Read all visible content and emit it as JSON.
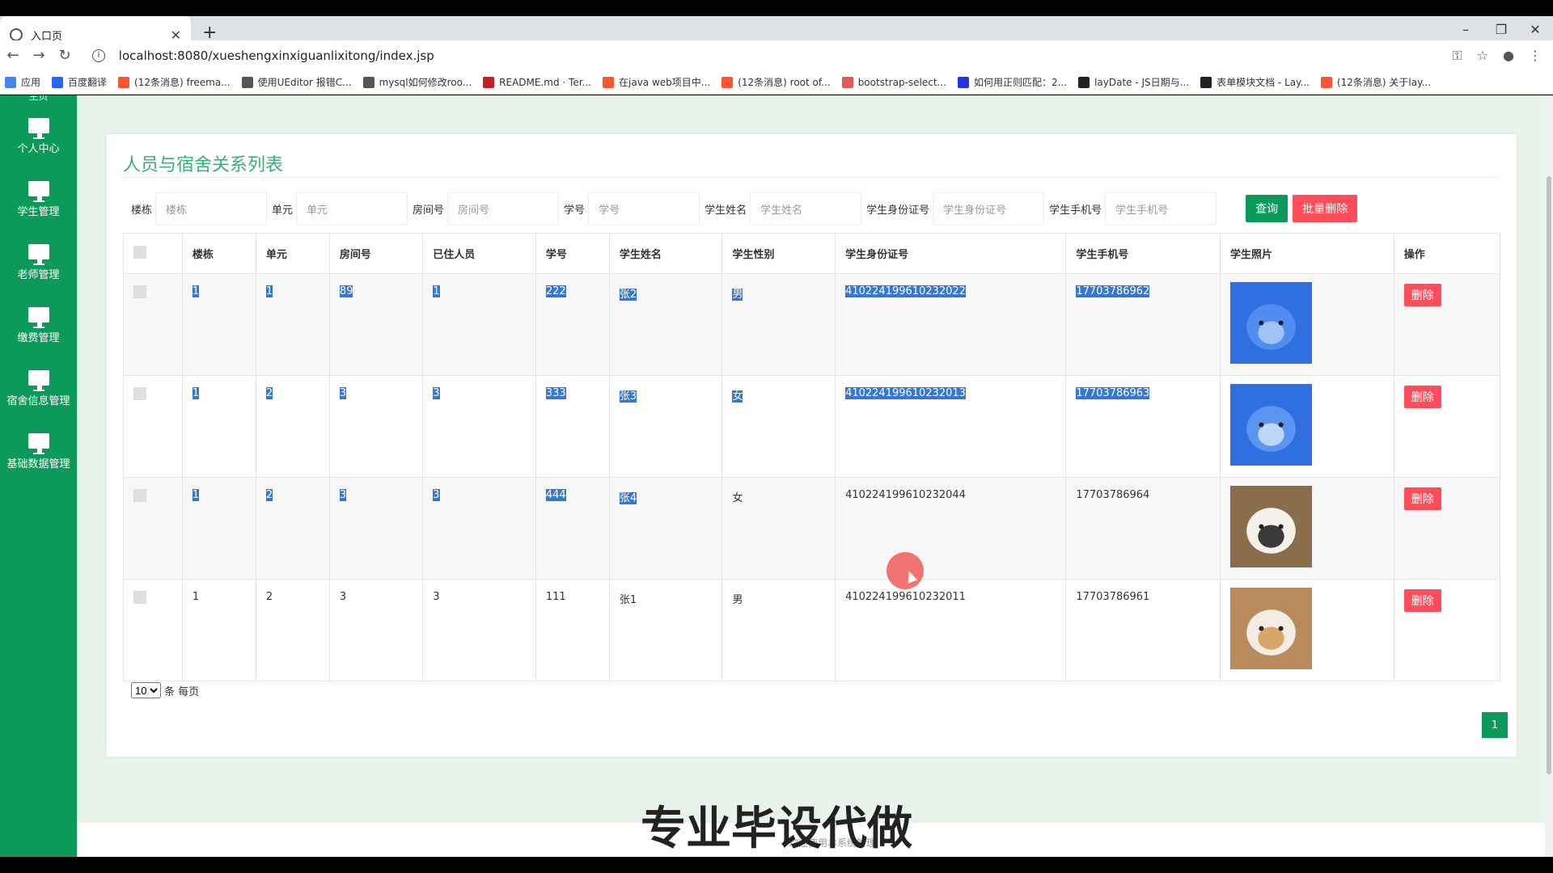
{
  "browser": {
    "tab_title": "入口页",
    "url": "localhost:8080/xueshengxinxiguanlixitong/index.jsp",
    "bookmarks": [
      {
        "label": "应用",
        "color": "#4285f4"
      },
      {
        "label": "百度翻译",
        "color": "#2468f2"
      },
      {
        "label": "(12条消息) freema...",
        "color": "#fc5531"
      },
      {
        "label": "使用UEditor 报错C...",
        "color": "#555555"
      },
      {
        "label": "mysql如何修改roo...",
        "color": "#555555"
      },
      {
        "label": "README.md · Ter...",
        "color": "#c71d23"
      },
      {
        "label": "在java web项目中...",
        "color": "#fc5531"
      },
      {
        "label": "(12条消息) root of...",
        "color": "#fc5531"
      },
      {
        "label": "bootstrap-select...",
        "color": "#e05a5a"
      },
      {
        "label": "如何用正则匹配：2...",
        "color": "#2932e1"
      },
      {
        "label": "layDate - JS日期与...",
        "color": "#222222"
      },
      {
        "label": "表单模块文档 - Lay...",
        "color": "#222222"
      },
      {
        "label": "(12条消息) 关于lay...",
        "color": "#fc5531"
      }
    ]
  },
  "sidebar": {
    "top_partial": "主页",
    "items": [
      {
        "label": "个人中心"
      },
      {
        "label": "学生管理"
      },
      {
        "label": "老师管理"
      },
      {
        "label": "缴费管理"
      },
      {
        "label": "宿舍信息管理"
      },
      {
        "label": "基础数据管理"
      }
    ]
  },
  "panel": {
    "title": "人员与宿舍关系列表",
    "filters": [
      {
        "label": "楼栋",
        "placeholder": "楼栋"
      },
      {
        "label": "单元",
        "placeholder": "单元"
      },
      {
        "label": "房间号",
        "placeholder": "房间号"
      },
      {
        "label": "学号",
        "placeholder": "学号"
      },
      {
        "label": "学生姓名",
        "placeholder": "学生姓名"
      },
      {
        "label": "学生身份证号",
        "placeholder": "学生身份证号"
      },
      {
        "label": "学生手机号",
        "placeholder": "学生手机号"
      }
    ],
    "search_button": "查询",
    "batch_delete_button": "批量删除"
  },
  "table": {
    "columns": [
      "楼栋",
      "单元",
      "房间号",
      "已住人员",
      "学号",
      "学生姓名",
      "学生性别",
      "学生身份证号",
      "学生手机号",
      "学生照片",
      "操作"
    ],
    "rows": [
      {
        "building": "1",
        "unit": "1",
        "room": "89",
        "occupants": "1",
        "student_no": "222",
        "name": "张2",
        "gender": "男",
        "id_card": "410224199610232022",
        "phone": "17703786962",
        "photo": "dog-photo",
        "action": "删除"
      },
      {
        "building": "1",
        "unit": "2",
        "room": "3",
        "occupants": "3",
        "student_no": "333",
        "name": "张3",
        "gender": "女",
        "id_card": "410224199610232013",
        "phone": "17703786963",
        "photo": "puppy-photo",
        "action": "删除"
      },
      {
        "building": "1",
        "unit": "2",
        "room": "3",
        "occupants": "3",
        "student_no": "444",
        "name": "张4",
        "gender": "女",
        "id_card": "410224199610232044",
        "phone": "17703786964",
        "photo": "cat-photo",
        "action": "删除"
      },
      {
        "building": "1",
        "unit": "2",
        "room": "3",
        "occupants": "3",
        "student_no": "111",
        "name": "张1",
        "gender": "男",
        "id_card": "410224199610232011",
        "phone": "17703786961",
        "photo": "cat-hat-photo",
        "action": "删除"
      }
    ]
  },
  "pagination": {
    "page_size": "10",
    "per_page_label": "条 每页",
    "current_page": "1"
  },
  "footer": {
    "text": "欢迎使用本系统管理"
  },
  "overlay_text": "专业毕设代做",
  "colors": {
    "primary": "#0b9a5a",
    "danger": "#ff4d5a",
    "title": "#3bb07a",
    "selection": "#3478d6"
  }
}
